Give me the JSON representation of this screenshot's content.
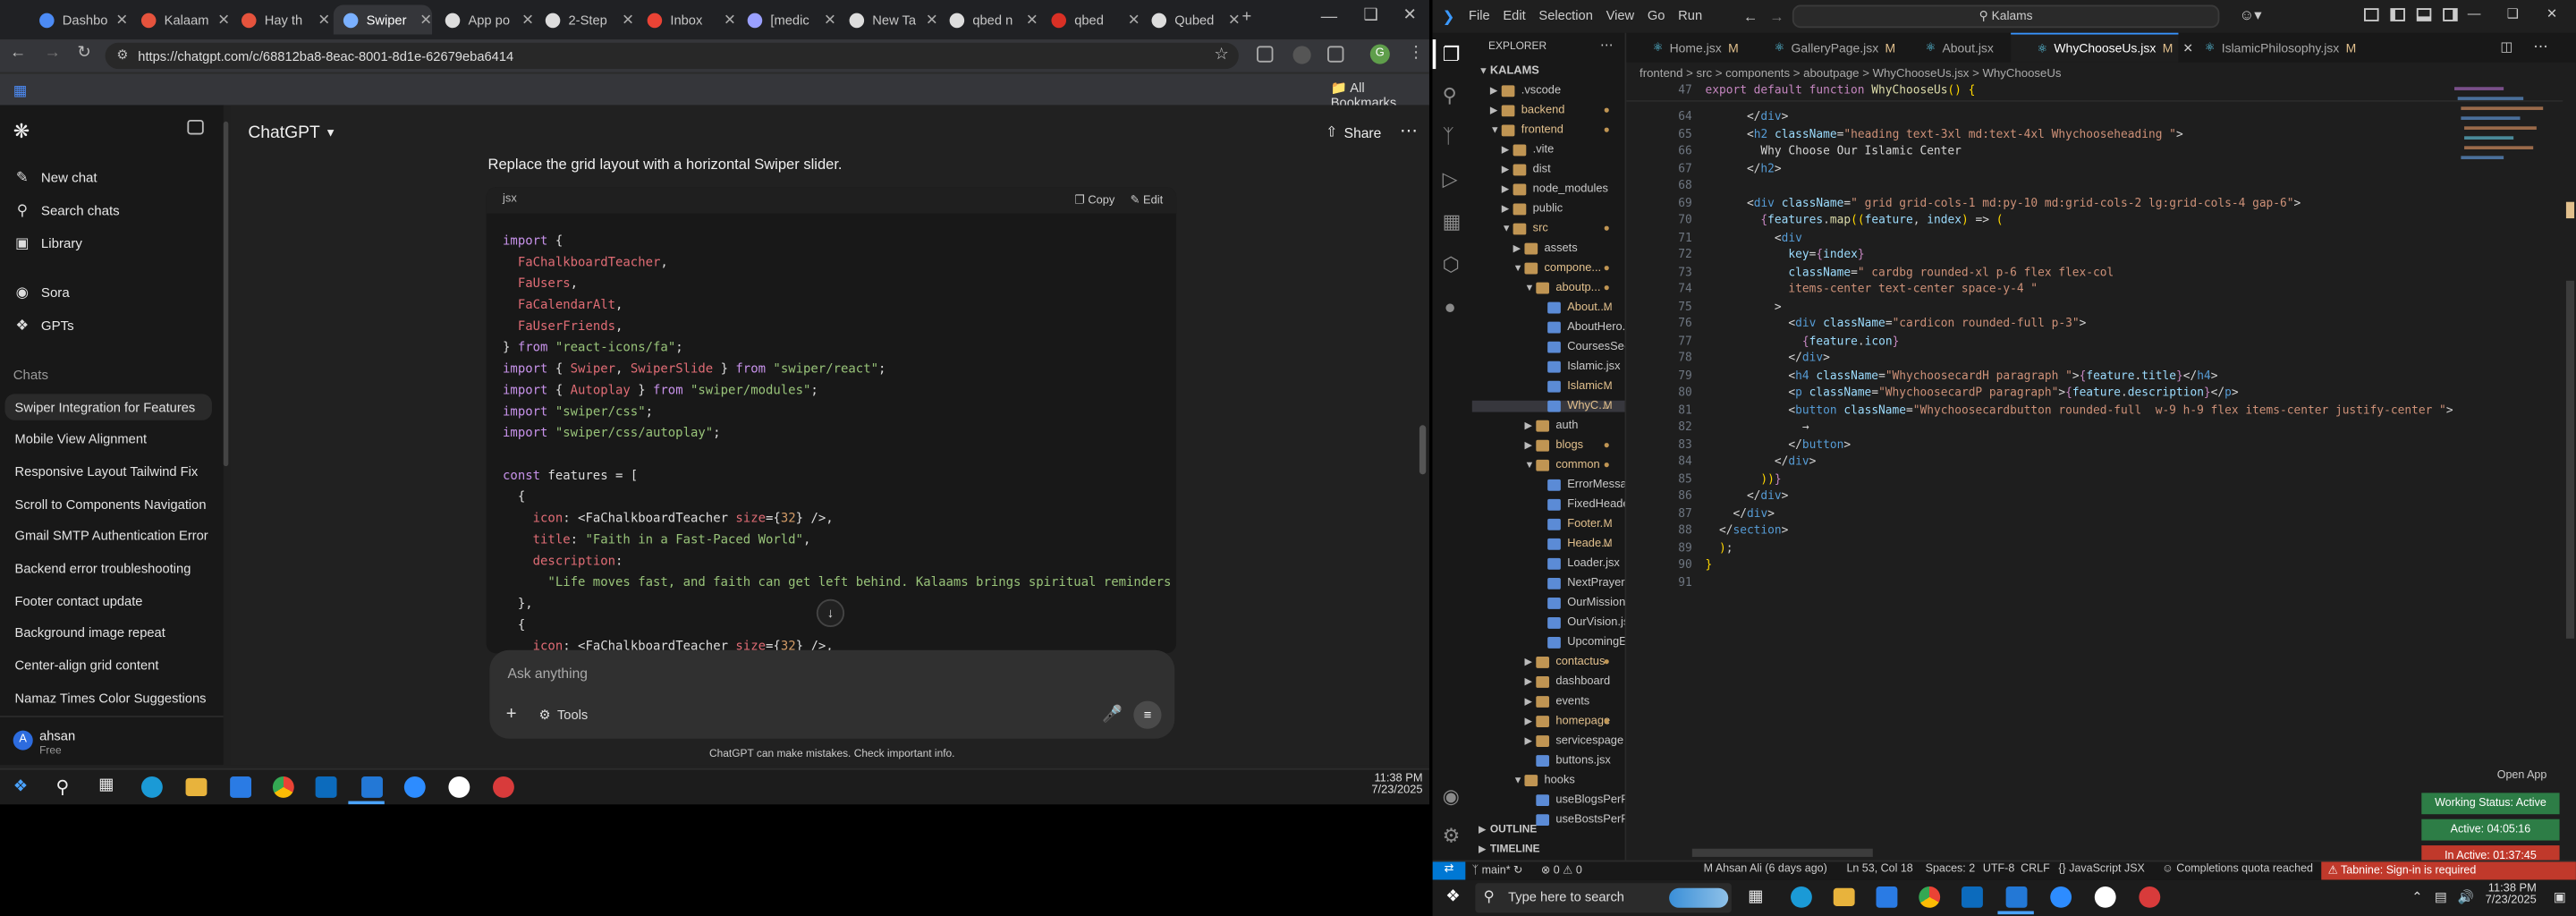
{
  "chrome": {
    "tabs": [
      {
        "label": "Dashbo",
        "color": "#4c8bf5"
      },
      {
        "label": "Kalaam",
        "color": "#e5533d"
      },
      {
        "label": "Hay th",
        "color": "#e5533d"
      },
      {
        "label": "Swiper",
        "color": "#7ab0ff",
        "active": true
      },
      {
        "label": "App po",
        "color": "#dddddd"
      },
      {
        "label": "2-Step",
        "color": "#dddddd"
      },
      {
        "label": "Inbox",
        "color": "#ea4335"
      },
      {
        "label": "[medic",
        "color": "#9aa0ff"
      },
      {
        "label": "New Ta",
        "color": "#dddddd"
      },
      {
        "label": "qbed n",
        "color": "#dddddd"
      },
      {
        "label": "qbed",
        "color": "#d93025"
      },
      {
        "label": "Qubed",
        "color": "#dddddd"
      }
    ],
    "url": "https://chatgpt.com/c/68812ba8-8eac-8001-8d1e-62679eba6414",
    "bookmarks_label": "All Bookmarks"
  },
  "gpt": {
    "model": "ChatGPT",
    "share_label": "Share",
    "side_items": [
      "New chat",
      "Search chats",
      "Library",
      "Sora",
      "GPTs"
    ],
    "chats_header": "Chats",
    "chats": [
      "Swiper Integration for Features",
      "Mobile View Alignment",
      "Responsive Layout Tailwind Fix",
      "Scroll to Components Navigation",
      "Gmail SMTP Authentication Error",
      "Backend error troubleshooting",
      "Footer contact update",
      "Background image repeat",
      "Center-align grid content",
      "Namaz Times Color Suggestions"
    ],
    "user_name": "ahsan",
    "user_plan": "Free",
    "user_initial": "A",
    "prompt_text": "Replace the grid layout with a horizontal Swiper slider.",
    "code_lang": "jsx",
    "copy_label": "Copy",
    "edit_label": "Edit",
    "ask_placeholder": "Ask anything",
    "tools_label": "Tools",
    "disclaimer": "ChatGPT can make mistakes. Check important info."
  },
  "clock_left": {
    "time": "11:38 PM",
    "date": "7/23/2025"
  },
  "vscode": {
    "menu": [
      "File",
      "Edit",
      "Selection",
      "View",
      "Go",
      "Run"
    ],
    "search": "Kalams",
    "explorer_title": "EXPLORER",
    "workspace": "KALAMS",
    "tabs": [
      {
        "label": "Home.jsx",
        "mod": "M"
      },
      {
        "label": "GalleryPage.jsx",
        "mod": "M"
      },
      {
        "label": "About.jsx",
        "mod": ""
      },
      {
        "label": "WhyChooseUs.jsx",
        "mod": "M",
        "active": true
      },
      {
        "label": "IslamicPhilosophy.jsx",
        "mod": "M"
      }
    ],
    "breadcrumb": "frontend  >  src  >  components  >  aboutpage  >  WhyChooseUs.jsx  >  WhyChooseUs",
    "status": {
      "branch": "main*",
      "errors": "0 ⚠ 0",
      "author": "M Ahsan Ali (6 days ago)",
      "position": "Ln 53, Col 18",
      "spaces": "Spaces: 2",
      "encoding": "UTF-8",
      "eol": "CRLF",
      "lang": "JavaScript JSX",
      "quota": "Completions quota reached",
      "tabnine": "Tabnine: Sign-in is required"
    },
    "open_app": "Open App",
    "working_status": "Working Status: Active",
    "active_time": "Active: 04:05:16",
    "inactive_time": "In Active: 01:37:45",
    "outline": "OUTLINE",
    "timeline": "TIMELINE"
  },
  "win_right": {
    "search": "Type here to search",
    "time": "11:38 PM",
    "date": "7/23/2025"
  }
}
